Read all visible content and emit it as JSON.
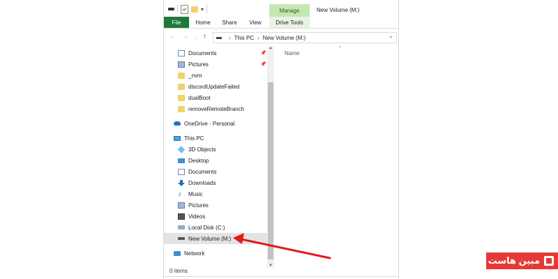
{
  "window": {
    "title": "New Volume (M:)",
    "manage_tab": "Manage",
    "tabs": [
      "File",
      "Home",
      "Share",
      "View"
    ],
    "drive_tools_tab": "Drive Tools"
  },
  "address": {
    "crumbs": [
      "This PC",
      "New Volume (M:)"
    ]
  },
  "nav": {
    "quick_access": [
      {
        "label": "Documents",
        "icon": "documents-icon",
        "pinned": true
      },
      {
        "label": "Pictures",
        "icon": "pictures-icon",
        "pinned": true
      },
      {
        "label": "_nvm",
        "icon": "folder-icon"
      },
      {
        "label": "discordUpdateFailed",
        "icon": "folder-icon"
      },
      {
        "label": "dualBoot",
        "icon": "folder-icon"
      },
      {
        "label": "removeRemoteBranch",
        "icon": "folder-icon"
      }
    ],
    "onedrive": "OneDrive - Personal",
    "this_pc": "This PC",
    "pc_items": [
      {
        "label": "3D Objects",
        "icon": "3d-objects-icon"
      },
      {
        "label": "Desktop",
        "icon": "desktop-icon"
      },
      {
        "label": "Documents",
        "icon": "documents-icon"
      },
      {
        "label": "Downloads",
        "icon": "downloads-icon"
      },
      {
        "label": "Music",
        "icon": "music-icon"
      },
      {
        "label": "Pictures",
        "icon": "pictures-icon"
      },
      {
        "label": "Videos",
        "icon": "videos-icon"
      },
      {
        "label": "Local Disk (C:)",
        "icon": "local-disk-icon"
      },
      {
        "label": "New Volume (M:)",
        "icon": "drive-icon",
        "selected": true
      }
    ],
    "network": "Network"
  },
  "content": {
    "column_name": "Name"
  },
  "status": {
    "items": "0 items"
  },
  "logo": {
    "text": "مبین هاست"
  },
  "colors": {
    "file_tab": "#1f7a3a",
    "manage_tab": "#c5e7b4",
    "arrow": "#e01b1b",
    "logo": "#e53935"
  }
}
